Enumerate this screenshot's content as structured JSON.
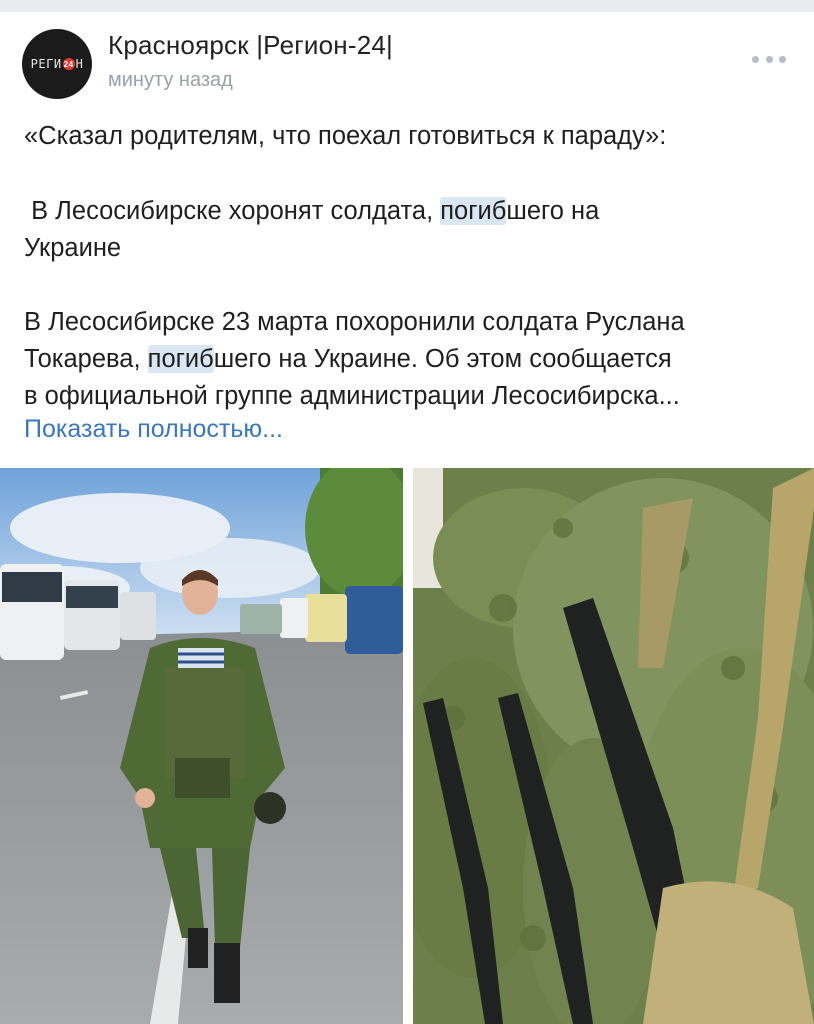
{
  "header": {
    "author_name": "Красноярск |Регион-24|",
    "timestamp": "минуту назад",
    "avatar_text": "РЕГИ",
    "avatar_badge": "24",
    "avatar_text_end": "Н",
    "more_icon": "ellipsis-icon"
  },
  "post": {
    "line1": "«Сказал родителям, что поехал готовиться к параду»:",
    "p2_before": " В Лесосибирске хоронят солдата, ",
    "p2_highlight": "погиб",
    "p2_after": "шего на",
    "p2_line2": "Украине",
    "p3_line1": "В Лесосибирске 23 марта похоронили солдата Руслана",
    "p3_line2_before": "Токарева, ",
    "p3_line2_highlight": "погиб",
    "p3_line2_after": "шего на Украине. Об этом сообщается",
    "p3_line3": "в официальной группе администрации Лесосибирска...",
    "show_more": "Показать полностью..."
  },
  "colors": {
    "link": "#3d77b8",
    "highlight": "#dbe6f3",
    "meta": "#9aa0a8"
  },
  "images": [
    {
      "name": "photo-soldier-street",
      "description_icon": "photo"
    },
    {
      "name": "photo-soldiers-rifles",
      "description_icon": "photo"
    }
  ]
}
